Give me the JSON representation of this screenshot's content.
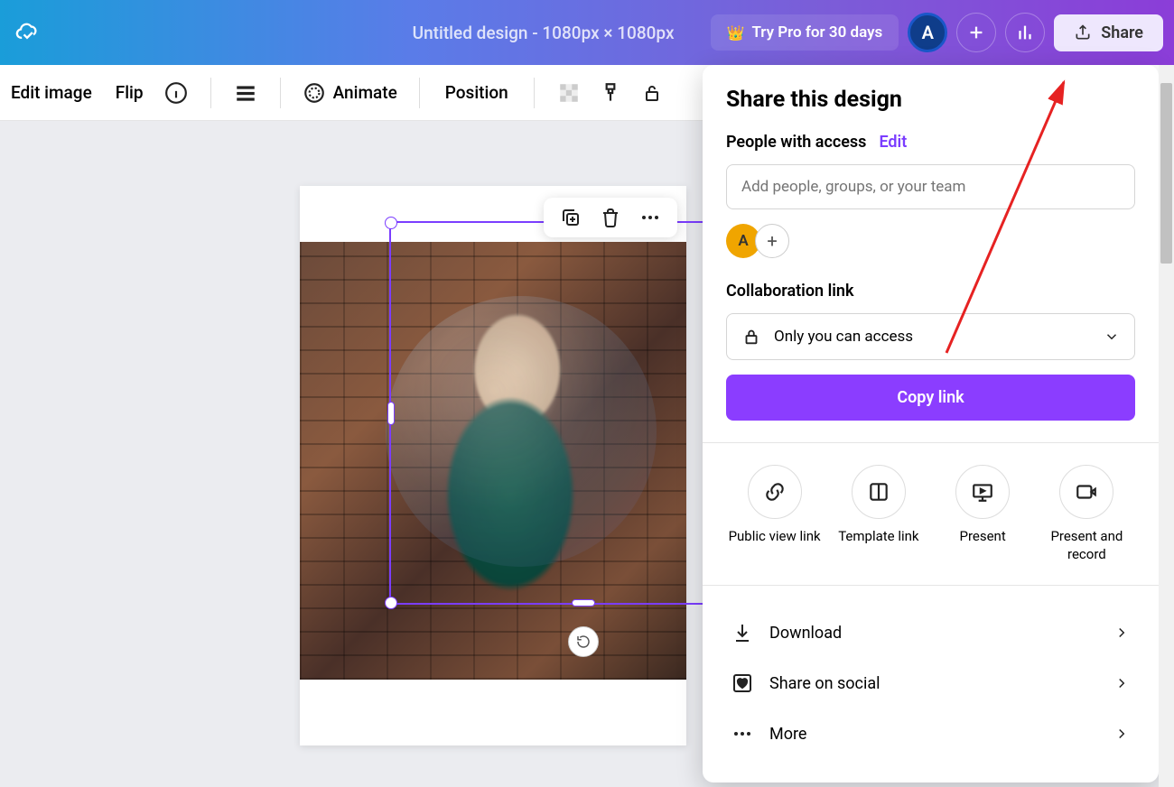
{
  "header": {
    "doc_title": "Untitled design - 1080px × 1080px",
    "try_pro": "Try Pro for 30 days",
    "avatar_letter": "A",
    "share_label": "Share"
  },
  "toolbar": {
    "edit_image": "Edit image",
    "flip": "Flip",
    "animate": "Animate",
    "position": "Position"
  },
  "share_panel": {
    "title": "Share this design",
    "access_label": "People with access",
    "edit_link": "Edit",
    "add_placeholder": "Add people, groups, or your team",
    "avatar_letter": "A",
    "collab_label": "Collaboration link",
    "access_value": "Only you can access",
    "copy_btn": "Copy link",
    "options": [
      {
        "label": "Public view link"
      },
      {
        "label": "Template link"
      },
      {
        "label": "Present"
      },
      {
        "label": "Present and record"
      }
    ],
    "menu": {
      "download": "Download",
      "share_social": "Share on social",
      "more": "More"
    }
  }
}
